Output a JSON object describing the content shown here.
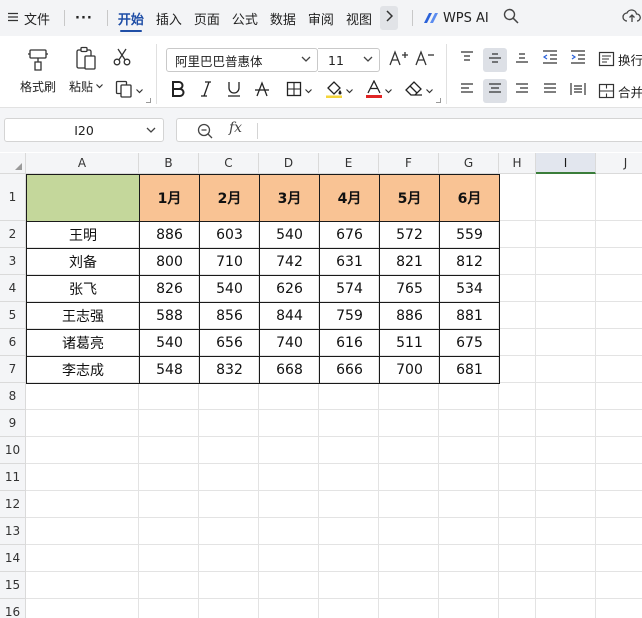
{
  "menubar": {
    "file_label": "文件",
    "more_label": "···",
    "tabs": [
      {
        "label": "开始",
        "active": true
      },
      {
        "label": "插入",
        "active": false
      },
      {
        "label": "页面",
        "active": false
      },
      {
        "label": "公式",
        "active": false
      },
      {
        "label": "数据",
        "active": false
      },
      {
        "label": "审阅",
        "active": false
      },
      {
        "label": "视图",
        "active": false
      }
    ],
    "wps_ai_label": "WPS AI"
  },
  "ribbon": {
    "format_painter_label": "格式刷",
    "paste_label": "粘贴",
    "font_name": "阿里巴巴普惠体",
    "font_size": "11",
    "wrap_text_label": "换行",
    "merge_label": "合并"
  },
  "formula_bar": {
    "cell_reference": "I20",
    "formula_value": ""
  },
  "sheet": {
    "columns": [
      "A",
      "B",
      "C",
      "D",
      "E",
      "F",
      "G",
      "H",
      "I",
      "J"
    ],
    "selected_column": "I",
    "rows": [
      "1",
      "2",
      "3",
      "4",
      "5",
      "6",
      "7",
      "8",
      "9",
      "10",
      "11",
      "12",
      "13",
      "14",
      "15",
      "16"
    ],
    "table_headers": [
      "",
      "1月",
      "2月",
      "3月",
      "4月",
      "5月",
      "6月"
    ],
    "table_rows": [
      [
        "王明",
        "886",
        "603",
        "540",
        "676",
        "572",
        "559"
      ],
      [
        "刘备",
        "800",
        "710",
        "742",
        "631",
        "821",
        "812"
      ],
      [
        "张飞",
        "826",
        "540",
        "626",
        "574",
        "765",
        "534"
      ],
      [
        "王志强",
        "588",
        "856",
        "844",
        "759",
        "886",
        "881"
      ],
      [
        "诸葛亮",
        "540",
        "656",
        "740",
        "616",
        "511",
        "675"
      ],
      [
        "李志成",
        "548",
        "832",
        "668",
        "666",
        "700",
        "681"
      ]
    ],
    "colors": {
      "header_fill": "#f9c394",
      "corner_fill": "#c4d79b",
      "accent": "#1f4ea6",
      "selected_column_underline": "#3a7d3a"
    }
  }
}
